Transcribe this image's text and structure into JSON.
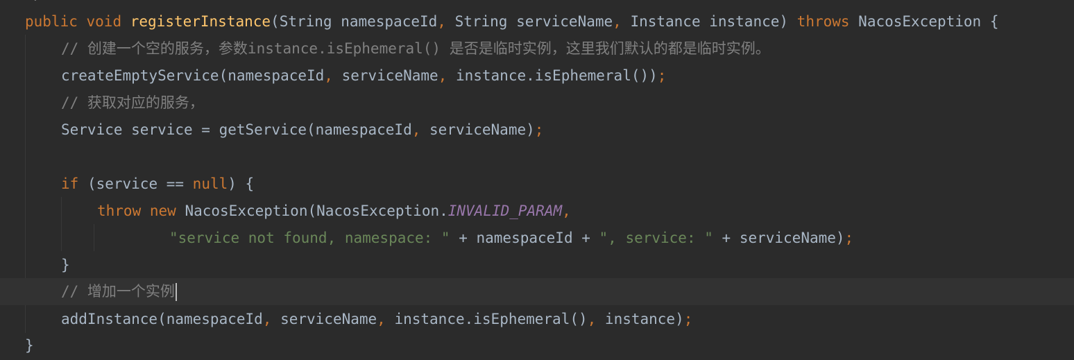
{
  "editor": {
    "line1": {
      "t1": "public",
      "t2": " ",
      "t3": "void",
      "t4": " ",
      "t5": "registerInstance",
      "t6": "(String namespaceId",
      "t7": ",",
      "t8": " String serviceName",
      "t9": ",",
      "t10": " Instance instance) ",
      "t11": "throws",
      "t12": " NacosException {"
    },
    "line2": {
      "comment": "// 创建一个空的服务，参数instance.isEphemeral() 是否是临时实例，这里我们默认的都是临时实例。"
    },
    "line3": {
      "t1": "createEmptyService(namespaceId",
      "t2": ",",
      "t3": " serviceName",
      "t4": ",",
      "t5": " instance.isEphemeral())",
      "t6": ";"
    },
    "line4": {
      "comment": "// 获取对应的服务，"
    },
    "line5": {
      "t1": "Service service = getService(namespaceId",
      "t2": ",",
      "t3": " serviceName)",
      "t4": ";"
    },
    "line7": {
      "t1": "if",
      "t2": " (service == ",
      "t3": "null",
      "t4": ") {"
    },
    "line8": {
      "t1": "throw",
      "t2": " ",
      "t3": "new",
      "t4": " NacosException(NacosException.",
      "t5": "INVALID_PARAM",
      "t6": ","
    },
    "line9": {
      "t1": "\"service not found, namespace: \"",
      "t2": " + namespaceId + ",
      "t3": "\", service: \"",
      "t4": " + serviceName)",
      "t5": ";"
    },
    "line10": {
      "t1": "}"
    },
    "line11": {
      "comment": "// 增加一个实例"
    },
    "line12": {
      "t1": "addInstance(namespaceId",
      "t2": ",",
      "t3": " serviceName",
      "t4": ",",
      "t5": " instance.isEphemeral()",
      "t6": ",",
      "t7": " instance)",
      "t8": ";"
    },
    "line13": {
      "t1": "}"
    },
    "top_fragment": "*/"
  },
  "colors": {
    "background": "#2b2b2b",
    "current_line": "#323232",
    "keyword": "#cc7832",
    "method": "#ffc66d",
    "comment": "#808080",
    "string": "#6a8759",
    "constant": "#9876aa",
    "text": "#a9b7c6"
  }
}
